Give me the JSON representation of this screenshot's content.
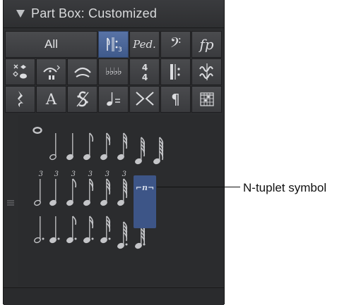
{
  "header": {
    "title": "Part Box: Customized",
    "collapse_icon": "disclosure-triangle-down"
  },
  "groups": {
    "all_label": "All",
    "rows": [
      [
        {
          "name": "group-all",
          "type": "text",
          "bind": "groups.all_label"
        },
        {
          "name": "group-notes",
          "icon": "notes-tuplet-icon",
          "selected": true
        },
        {
          "name": "group-pedal",
          "icon": "pedal-icon",
          "glyph": "Ped."
        },
        {
          "name": "group-clefs",
          "icon": "bass-clef-icon",
          "glyph": "𝄢"
        },
        {
          "name": "group-dynamics",
          "icon": "dynamics-icon",
          "glyph": "fp"
        }
      ],
      [
        {
          "name": "group-noteheads",
          "icon": "noteheads-icon"
        },
        {
          "name": "group-ornaments",
          "icon": "ornaments-icon"
        },
        {
          "name": "group-slurs",
          "icon": "slur-icon"
        },
        {
          "name": "group-key-signatures",
          "icon": "flats-icon",
          "glyph": "♭♭♭♭"
        },
        {
          "name": "group-time-signatures",
          "icon": "time-signature-icon",
          "glyph": "4/4"
        },
        {
          "name": "group-repeats",
          "icon": "repeat-barline-icon"
        },
        {
          "name": "group-trills",
          "icon": "trill-icon"
        }
      ],
      [
        {
          "name": "group-rests",
          "icon": "quarter-rest-icon",
          "glyph": "𝄽"
        },
        {
          "name": "group-text",
          "icon": "text-icon",
          "glyph": "A"
        },
        {
          "name": "group-segno",
          "icon": "segno-icon",
          "glyph": "𝄋"
        },
        {
          "name": "group-tempo",
          "icon": "tempo-icon",
          "glyph": "♩="
        },
        {
          "name": "group-hairpins",
          "icon": "hairpin-icon"
        },
        {
          "name": "group-symbols",
          "icon": "pilcrow-icon",
          "glyph": "¶"
        },
        {
          "name": "group-chord-grids",
          "icon": "chord-grid-icon"
        }
      ]
    ]
  },
  "tuplet_digit": "3",
  "ntuplet_glyph": "⌐n¬",
  "callout": {
    "label": "N-tuplet symbol"
  },
  "colors": {
    "panel": "#2c2d2f",
    "selected": "#4a6699",
    "symbol": "#c9cacc",
    "text": "#d9dadc"
  }
}
